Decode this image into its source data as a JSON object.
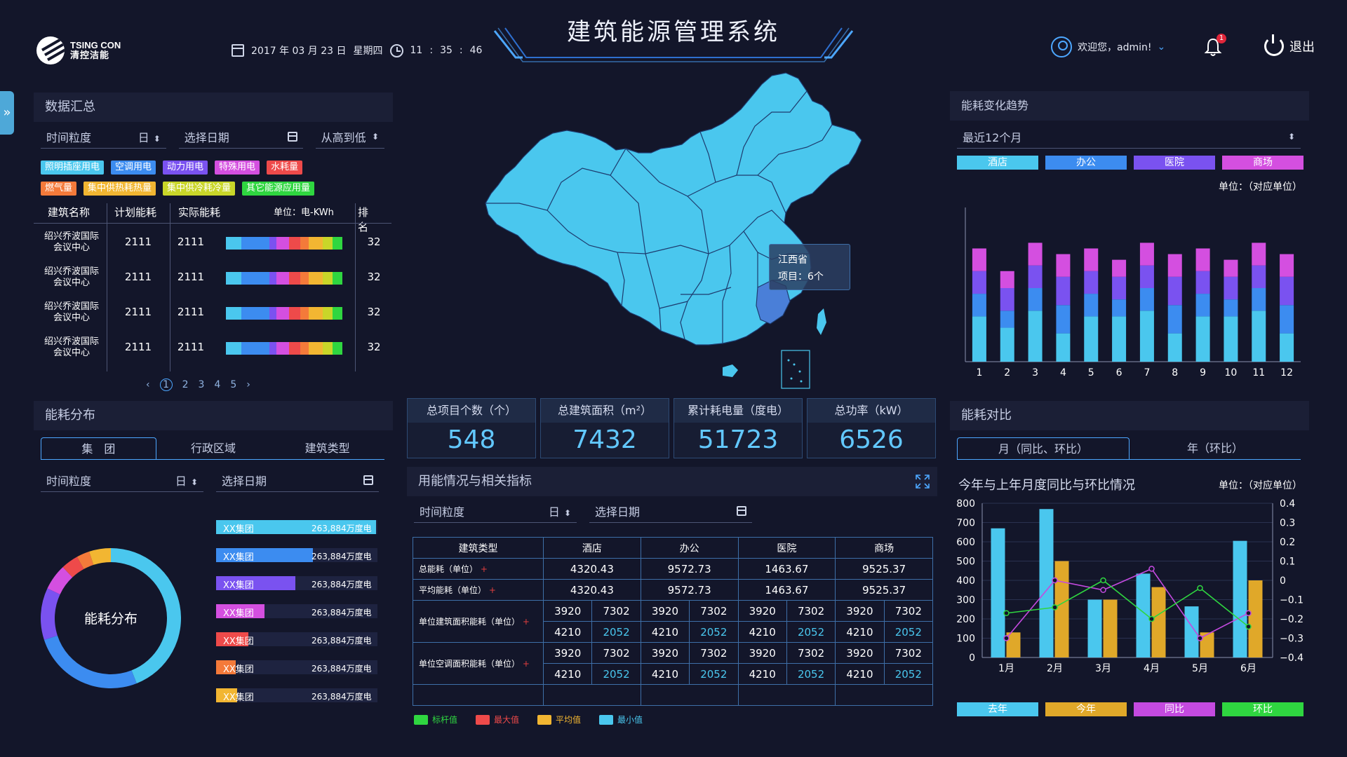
{
  "header": {
    "brand_en": "TSING CON",
    "brand_cn": "清控洁能",
    "date": "2017 年 03 月 23 日",
    "weekday": "星期四",
    "time_h": "11",
    "time_m": "35",
    "time_s": "46",
    "title": "建筑能源管理系统",
    "welcome": "欢迎您，admin!",
    "notification_count": "1",
    "logout": "退出",
    "colors": {
      "accent": "#4da7ff",
      "cyan": "#4ac7ee"
    }
  },
  "summary": {
    "title": "数据汇总",
    "granularity_label": "时间粒度",
    "granularity_value": "日",
    "date_label": "选择日期",
    "sort_label": "从高到低",
    "tags": [
      {
        "label": "照明插座用电",
        "color": "#4ac7ee"
      },
      {
        "label": "空调用电",
        "color": "#3c8cf0"
      },
      {
        "label": "动力用电",
        "color": "#7a52f0"
      },
      {
        "label": "特殊用电",
        "color": "#d44fe0"
      },
      {
        "label": "水耗量",
        "color": "#ee4a4a"
      },
      {
        "label": "燃气量",
        "color": "#f47a3a"
      },
      {
        "label": "集中供热耗热量",
        "color": "#f2b632"
      },
      {
        "label": "集中供冷耗冷量",
        "color": "#c9d629"
      },
      {
        "label": "其它能源应用量",
        "color": "#2fd640"
      }
    ],
    "columns": [
      "建筑名称",
      "计划能耗",
      "实际能耗",
      "单位：电-KWh",
      "排名"
    ],
    "rows": [
      {
        "name1": "绍兴乔波国际",
        "name2": "会议中心",
        "plan": "2111",
        "actual": "2111",
        "rank": "32"
      },
      {
        "name1": "绍兴乔波国际",
        "name2": "会议中心",
        "plan": "2111",
        "actual": "2111",
        "rank": "32"
      },
      {
        "name1": "绍兴乔波国际",
        "name2": "会议中心",
        "plan": "2111",
        "actual": "2111",
        "rank": "32"
      },
      {
        "name1": "绍兴乔波国际",
        "name2": "会议中心",
        "plan": "2111",
        "actual": "2111",
        "rank": "32"
      }
    ],
    "pages": [
      "1",
      "2",
      "3",
      "4",
      "5"
    ],
    "current_page": "1"
  },
  "distribution": {
    "title": "能耗分布",
    "tabs": [
      "集　团",
      "行政区域",
      "建筑类型"
    ],
    "granularity_label": "时间粒度",
    "granularity_value": "日",
    "date_label": "选择日期",
    "donut_label": "能耗分布",
    "items": [
      {
        "name": "XX集团",
        "value": "263,884万度电",
        "fill": 0.99,
        "color": "#4ac7ee"
      },
      {
        "name": "XX集团",
        "value": "263,884万度电",
        "fill": 0.6,
        "color": "#3c8cf0"
      },
      {
        "name": "XX集团",
        "value": "263,884万度电",
        "fill": 0.49,
        "color": "#7a52f0"
      },
      {
        "name": "XX集团",
        "value": "263,884万度电",
        "fill": 0.3,
        "color": "#d44fe0"
      },
      {
        "name": "XX集团",
        "value": "263,884万度电",
        "fill": 0.2,
        "color": "#ee4a4a"
      },
      {
        "name": "XX集团",
        "value": "263,884万度电",
        "fill": 0.12,
        "color": "#f47a3a"
      },
      {
        "name": "XX集团",
        "value": "263,884万度电",
        "fill": 0.13,
        "color": "#f2b632"
      }
    ]
  },
  "map": {
    "tooltip_title": "江西省",
    "tooltip_value": "项目：6个"
  },
  "stats": [
    {
      "label": "总项目个数（个）",
      "value": "548"
    },
    {
      "label": "总建筑面积（m²）",
      "value": "7432"
    },
    {
      "label": "累计耗电量（度电）",
      "value": "51723"
    },
    {
      "label": "总功率（kW）",
      "value": "6526"
    }
  ],
  "usage": {
    "title": "用能情况与相关指标",
    "granularity_label": "时间粒度",
    "granularity_value": "日",
    "date_label": "选择日期",
    "headers": [
      "建筑类型",
      "酒店",
      "办公",
      "医院",
      "商场"
    ],
    "total_label": "总能耗（单位）",
    "avg_label": "平均能耗（单位）",
    "unit_area_label": "单位建筑面积能耗（单位）",
    "unit_ac_label": "单位空调面积能耗（单位）",
    "total": [
      "4320.43",
      "9572.73",
      "1463.67",
      "9525.37"
    ],
    "avg": [
      "4320.43",
      "9572.73",
      "1463.67",
      "9525.37"
    ],
    "v_green": "3920",
    "v_red": "7302",
    "v_yellow": "4210",
    "v_blue": "2052",
    "legend": [
      {
        "label": "标杆值",
        "color": "#2fd640"
      },
      {
        "label": "最大值",
        "color": "#ee4a4a"
      },
      {
        "label": "平均值",
        "color": "#f2b632"
      },
      {
        "label": "最小值",
        "color": "#4ac7ee"
      }
    ]
  },
  "trend": {
    "title": "能耗变化趋势",
    "period": "最近12个月",
    "unit": "单位：（对应单位）",
    "legend": [
      {
        "label": "酒店",
        "color": "#4ac7ee"
      },
      {
        "label": "办公",
        "color": "#3c8cf0"
      },
      {
        "label": "医院",
        "color": "#7a52f0"
      },
      {
        "label": "商场",
        "color": "#d44fe0"
      }
    ]
  },
  "compare": {
    "title": "能耗对比",
    "tabs": [
      "月（同比、环比）",
      "年（环比）"
    ],
    "chart_title": "今年与上年月度同比与环比情况",
    "unit": "单位：（对应单位）",
    "legend": [
      {
        "label": "去年",
        "color": "#4ac7ee"
      },
      {
        "label": "今年",
        "color": "#e0a829"
      },
      {
        "label": "同比",
        "color": "#c44ae0"
      },
      {
        "label": "环比",
        "color": "#2fd640"
      }
    ]
  },
  "chart_data": [
    {
      "type": "bar",
      "title": "",
      "categories": [
        "1",
        "2",
        "3",
        "4",
        "5",
        "6",
        "7",
        "8",
        "9",
        "10",
        "11",
        "12"
      ],
      "stacked": true,
      "series": [
        {
          "name": "酒店",
          "values": [
            40,
            30,
            45,
            25,
            40,
            40,
            45,
            25,
            40,
            40,
            45,
            25
          ]
        },
        {
          "name": "办公",
          "values": [
            20,
            15,
            20,
            25,
            20,
            15,
            20,
            25,
            20,
            15,
            20,
            25
          ]
        },
        {
          "name": "医院",
          "values": [
            20,
            20,
            20,
            25,
            20,
            20,
            20,
            25,
            20,
            20,
            20,
            25
          ]
        },
        {
          "name": "商场",
          "values": [
            20,
            15,
            20,
            20,
            20,
            15,
            20,
            20,
            20,
            15,
            20,
            20
          ]
        }
      ],
      "ylim": [
        0,
        130
      ],
      "grid": false
    },
    {
      "type": "bar",
      "title": "今年与上年月度同比与环比情况",
      "categories": [
        "1月",
        "2月",
        "3月",
        "4月",
        "5月",
        "6月"
      ],
      "series": [
        {
          "name": "去年",
          "values": [
            670,
            770,
            300,
            435,
            265,
            605
          ],
          "axis": "left"
        },
        {
          "name": "今年",
          "values": [
            130,
            500,
            300,
            365,
            130,
            400
          ],
          "axis": "left"
        },
        {
          "name": "同比",
          "values": [
            -0.3,
            0.0,
            -0.05,
            0.06,
            -0.3,
            -0.17
          ],
          "axis": "right",
          "type": "line"
        },
        {
          "name": "环比",
          "values": [
            -0.17,
            -0.14,
            0.0,
            -0.2,
            -0.04,
            -0.24
          ],
          "axis": "right",
          "type": "line"
        }
      ],
      "ylim": [
        0,
        800
      ],
      "ylim_right": [
        -0.4,
        0.4
      ],
      "yticks": [
        0,
        100,
        200,
        300,
        400,
        500,
        600,
        700,
        800
      ],
      "yticks_right": [
        "0.4",
        "0.3",
        "0.2",
        "0.1",
        "0",
        "−0.1",
        "−0.2",
        "−0.3",
        "−0.4"
      ],
      "grid": true
    }
  ]
}
